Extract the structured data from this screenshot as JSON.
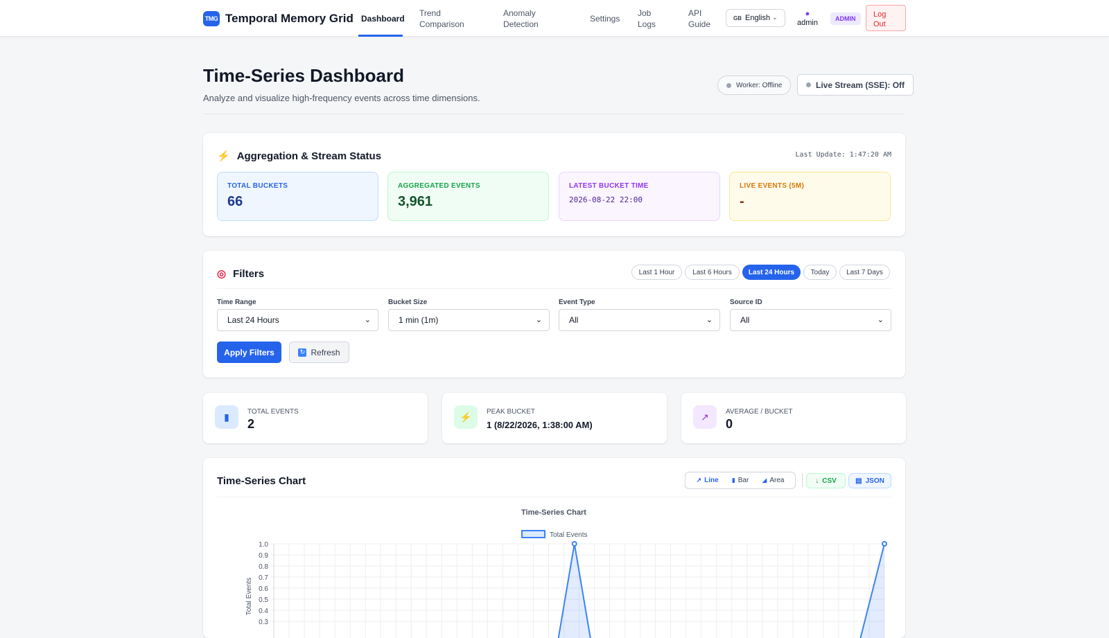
{
  "nav": {
    "logo": "TMG",
    "brand": "Temporal Memory Grid",
    "links": {
      "dashboard": "Dashboard",
      "trend_1": "Trend",
      "trend_2": "Comparison",
      "anomaly_1": "Anomaly",
      "anomaly_2": "Detection",
      "settings": "Settings",
      "joblogs_1": "Job",
      "joblogs_2": "Logs",
      "api_1": "API",
      "api_2": "Guide"
    },
    "language": {
      "flag": "GB",
      "label": "English"
    },
    "user": "admin",
    "role_badge": "ADMIN",
    "logout_1": "Log",
    "logout_2": "Out"
  },
  "header": {
    "title": "Time-Series Dashboard",
    "subtitle": "Analyze and visualize high-frequency events across time dimensions.",
    "worker_status": "Worker: Offline",
    "live_stream": "Live Stream (SSE): Off"
  },
  "aggregation": {
    "title": "Aggregation & Stream Status",
    "last_update": "Last Update: 1:47:20 AM",
    "total_buckets_label": "TOTAL BUCKETS",
    "total_buckets_value": "66",
    "aggregated_events_label": "AGGREGATED EVENTS",
    "aggregated_events_value": "3,961",
    "latest_bucket_label": "LATEST BUCKET TIME",
    "latest_bucket_value": "2026-08-22 22:00",
    "live_events_label": "LIVE EVENTS (5M)",
    "live_events_value": "-",
    "colors": {
      "blue": "#2563eb",
      "green": "#16a34a",
      "purple": "#9333ea",
      "amber": "#d97706"
    }
  },
  "filters": {
    "title": "Filters",
    "quick": [
      "Last 1 Hour",
      "Last 6 Hours",
      "Last 24 Hours",
      "Today",
      "Last 7 Days"
    ],
    "quick_active_index": 2,
    "time_range_label": "Time Range",
    "time_range_value": "Last 24 Hours",
    "bucket_size_label": "Bucket Size",
    "bucket_size_value": "1 min (1m)",
    "event_type_label": "Event Type",
    "event_type_value": "All",
    "source_id_label": "Source ID",
    "source_id_value": "All",
    "apply": "Apply Filters",
    "refresh": "Refresh"
  },
  "summary": {
    "total_events_label": "TOTAL EVENTS",
    "total_events_value": "2",
    "peak_bucket_label": "PEAK BUCKET",
    "peak_bucket_value": "1 (8/22/2026, 1:38:00 AM)",
    "average_label": "AVERAGE / BUCKET",
    "average_value": "0"
  },
  "chart_card": {
    "title": "Time-Series Chart",
    "toggle": {
      "line": "Line",
      "bar": "Bar",
      "area": "Area",
      "active": "line"
    },
    "export_csv": "CSV",
    "export_json": "JSON"
  },
  "chart_data": {
    "type": "area",
    "title": "Time-Series Chart",
    "xlabel": "",
    "ylabel": "Total Events",
    "ylim": [
      0,
      1.0
    ],
    "y_ticks": [
      "1.0",
      "0.9",
      "0.8",
      "0.7",
      "0.6",
      "0.5",
      "0.4",
      "0.3"
    ],
    "grid": true,
    "legend": "top",
    "series": [
      {
        "name": "Total Events",
        "color": "#3b82f6",
        "points": [
          {
            "index": 0,
            "y": 0
          },
          {
            "index": 30,
            "y": 0
          },
          {
            "index": 32,
            "y": 1
          },
          {
            "index": 34,
            "y": 0
          },
          {
            "index": 62,
            "y": 0
          },
          {
            "index": 65,
            "y": 1
          }
        ]
      }
    ],
    "x_count": 66
  }
}
